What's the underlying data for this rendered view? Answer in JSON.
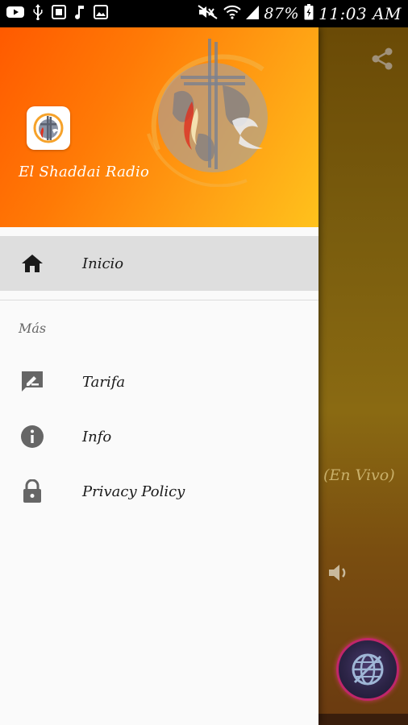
{
  "status_bar": {
    "battery": "87%",
    "time": "11:03 AM",
    "left_icons": [
      "youtube-icon",
      "usb-icon",
      "screenshot-icon",
      "music-icon",
      "image-icon"
    ],
    "right_icons": [
      "mute-icon",
      "wifi-icon",
      "signal-icon",
      "battery-icon"
    ]
  },
  "drawer": {
    "app_name": "El Shaddai Radio",
    "items": [
      {
        "label": "Inicio",
        "icon": "home-icon",
        "active": true
      }
    ],
    "section_label": "Más",
    "more_items": [
      {
        "label": "Tarifa",
        "icon": "rate-review-icon"
      },
      {
        "label": "Info",
        "icon": "info-icon"
      },
      {
        "label": "Privacy Policy",
        "icon": "lock-icon"
      }
    ]
  },
  "background_app": {
    "live_label": "(En Vivo)",
    "icons": [
      "share-icon",
      "volume-icon",
      "globe-play-button-icon"
    ]
  },
  "colors": {
    "header_gradient_start": "#ff5a00",
    "header_gradient_end": "#ffc21c",
    "active_item_bg": "#dedede",
    "fab_ring": "#c0266a"
  }
}
